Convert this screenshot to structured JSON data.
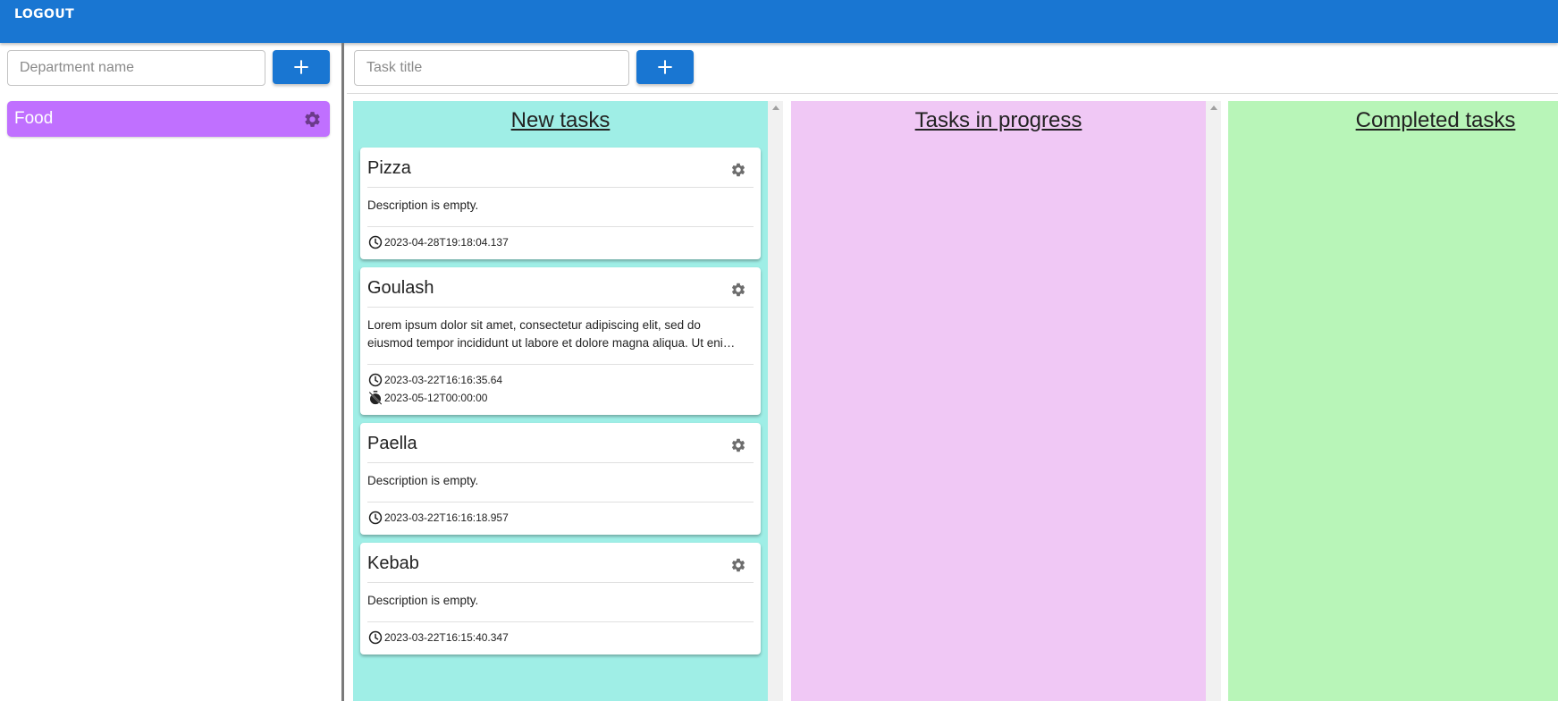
{
  "header": {
    "logout_label": "LOGOUT"
  },
  "sidebar": {
    "department_input": {
      "placeholder": "Department name",
      "value": ""
    },
    "add_label": "+",
    "departments": [
      {
        "name": "Food",
        "color": "#c070ff"
      }
    ]
  },
  "toolbar": {
    "task_input": {
      "placeholder": "Task title",
      "value": ""
    },
    "add_label": "+"
  },
  "columns": [
    {
      "title": "New tasks",
      "color": "#9feee6",
      "tasks": [
        {
          "title": "Pizza",
          "description": "Description is empty.",
          "created": "2023-04-28T19:18:04.137"
        },
        {
          "title": "Goulash",
          "description": "Lorem ipsum dolor sit amet, consectetur adipiscing elit, sed do eiusmod tempor incididunt ut labore et dolore magna aliqua. Ut enim ad minim veniam, quis nostrud exercitation ullamco laboris.",
          "created": "2023-03-22T16:16:35.64",
          "deadline": "2023-05-12T00:00:00"
        },
        {
          "title": "Paella",
          "description": "Description is empty.",
          "created": "2023-03-22T16:16:18.957"
        },
        {
          "title": "Kebab",
          "description": "Description is empty.",
          "created": "2023-03-22T16:15:40.347"
        }
      ]
    },
    {
      "title": "Tasks in progress",
      "color": "#f0c8f5",
      "tasks": []
    },
    {
      "title": "Completed tasks",
      "color": "#b8f5b8",
      "tasks": []
    }
  ],
  "icons": {
    "gear": "gear-icon",
    "clock": "clock-icon",
    "deadline": "timer-off-icon",
    "plus": "plus-icon"
  },
  "colors": {
    "primary": "#1976d2",
    "department": "#c070ff"
  }
}
